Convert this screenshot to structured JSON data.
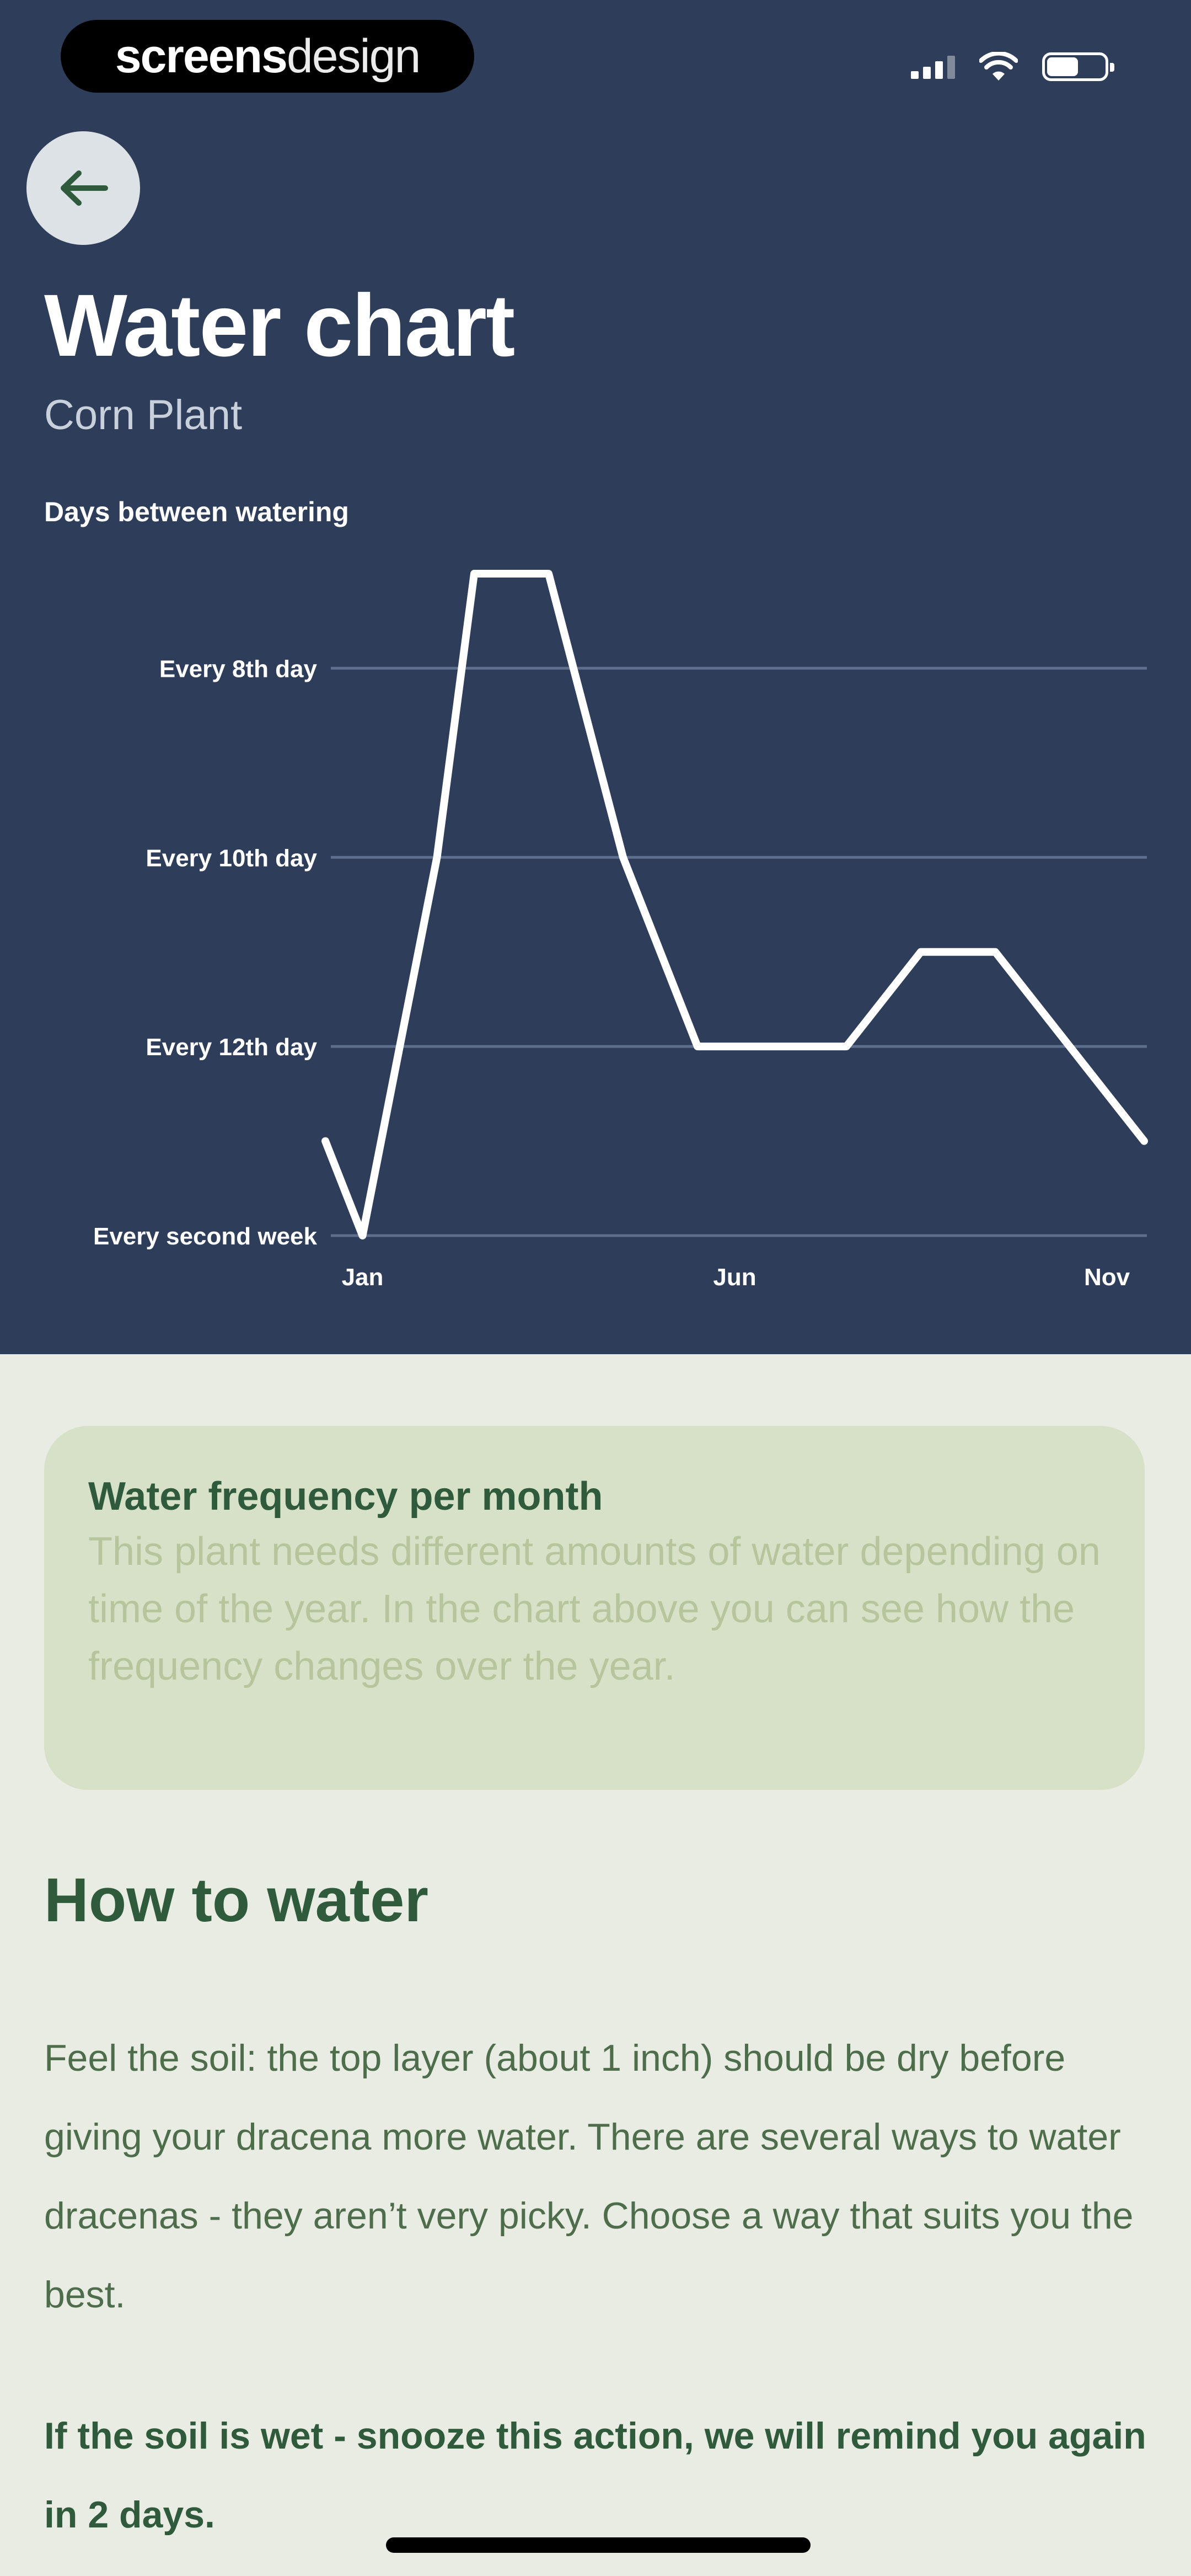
{
  "status_bar": {
    "logo_bold": "screens",
    "logo_light": "design",
    "signal_icon": "cellular-signal-icon",
    "wifi_icon": "wifi-icon",
    "battery_icon": "battery-icon",
    "battery_level": 0.55
  },
  "nav": {
    "back_icon": "arrow-left-icon"
  },
  "header": {
    "title": "Water chart",
    "subtitle": "Corn Plant",
    "chart_label": "Days between watering"
  },
  "chart_data": {
    "type": "line",
    "ylabel": "Days between watering",
    "y_ticks": [
      "Every 8th day",
      "Every 10th day",
      "Every 12th day",
      "Every second week"
    ],
    "y_tick_values": [
      8,
      10,
      12,
      14
    ],
    "ylim": [
      7,
      14
    ],
    "y_inverted": true,
    "x_ticks": [
      "Jan",
      "Jun",
      "Nov"
    ],
    "x_tick_positions": [
      1,
      6,
      11
    ],
    "xlim": [
      0.5,
      11.5
    ],
    "grid": true,
    "line_color": "#FFFFFF",
    "series": [
      {
        "x": [
          0.5,
          1,
          2,
          2.5,
          3.5,
          4.5,
          5.5,
          7.5,
          8.5,
          9.5,
          11.5
        ],
        "values": [
          13,
          14,
          10,
          7,
          7,
          10,
          12,
          12,
          11,
          11,
          13
        ]
      }
    ]
  },
  "info_card": {
    "title": "Water frequency per month",
    "text": "This plant needs different amounts of water depending on time of the year. In the chart above you can see how the frequency changes over the year."
  },
  "how_to": {
    "title": "How to water",
    "body": "Feel the soil: the top layer (about 1 inch) should be dry before giving your dracena more water. There are several ways to water dracenas - they aren’t very picky. Choose a way that suits you the best.",
    "note": "If the soil is wet - snooze this action, we will remind you again in 2 days."
  },
  "colors": {
    "header_bg": "#2E3D59",
    "page_bg": "#E8ECE3",
    "card_bg": "#D7E1C7",
    "accent_green": "#2F5A3B"
  }
}
